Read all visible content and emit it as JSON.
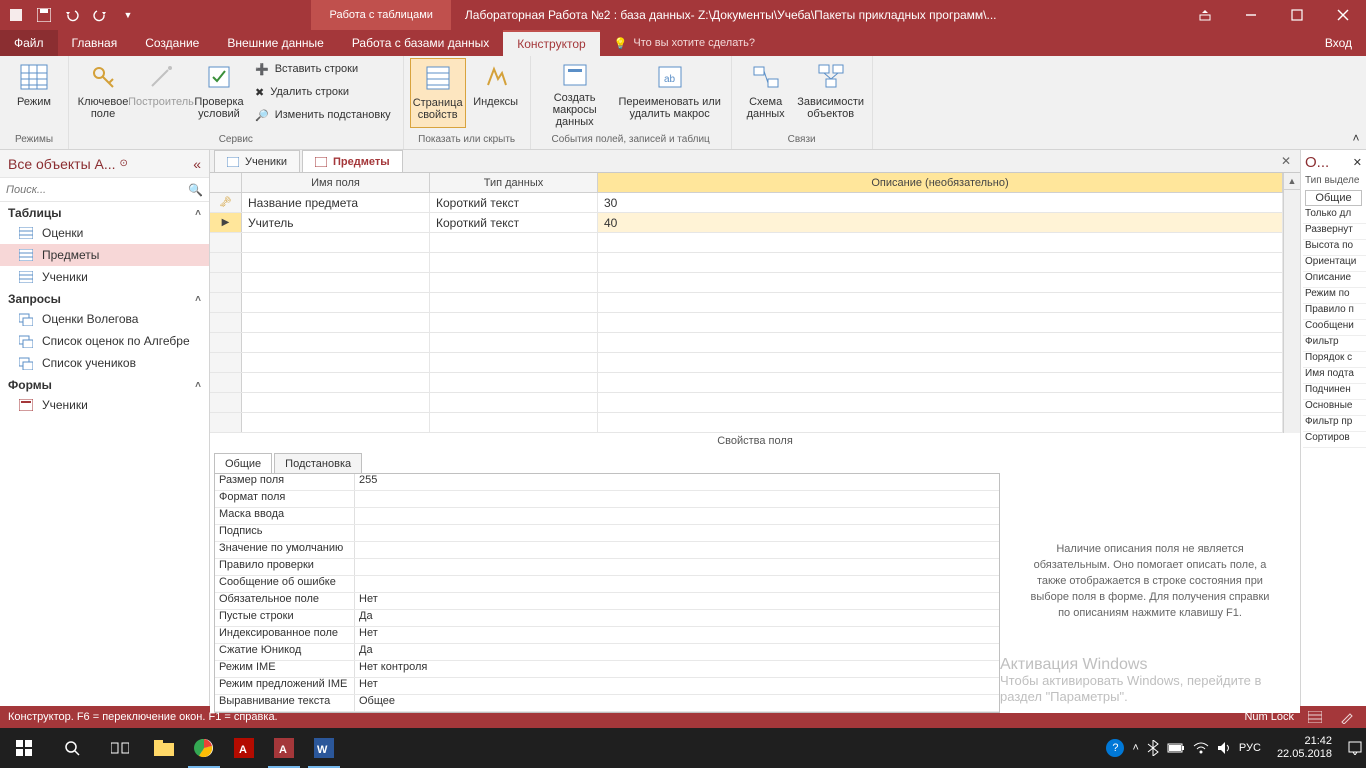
{
  "titlebar": {
    "context_label": "Работа с таблицами",
    "title": "Лабораторная Работа №2 : база данных- Z:\\Документы\\Учеба\\Пакеты прикладных программ\\..."
  },
  "ribbon_tabs": {
    "file": "Файл",
    "home": "Главная",
    "create": "Создание",
    "external": "Внешние данные",
    "dbtools": "Работа с базами данных",
    "design": "Конструктор",
    "tellme": "Что вы хотите сделать?",
    "signin": "Вход"
  },
  "ribbon": {
    "views": {
      "label": "Режимы",
      "view": "Режим"
    },
    "service": {
      "label": "Сервис",
      "pk": "Ключевое поле",
      "builder": "Построитель",
      "validate": "Проверка условий",
      "insert": "Вставить строки",
      "delete": "Удалить строки",
      "lookup": "Изменить подстановку"
    },
    "showhide": {
      "label": "Показать или скрыть",
      "propsheet": "Страница свойств",
      "indexes": "Индексы"
    },
    "events": {
      "label": "События полей, записей и таблиц",
      "datamacro": "Создать макросы данных",
      "rename": "Переименовать или удалить макрос"
    },
    "relations": {
      "label": "Связи",
      "rel": "Схема данных",
      "deps": "Зависимости объектов"
    }
  },
  "nav": {
    "header": "Все объекты A...",
    "search": "Поиск...",
    "groups": {
      "tables": "Таблицы",
      "queries": "Запросы",
      "forms": "Формы"
    },
    "tables": [
      "Оценки",
      "Предметы",
      "Ученики"
    ],
    "queries": [
      "Оценки Волегова",
      "Список оценок по Алгебре",
      "Список учеников"
    ],
    "forms": [
      "Ученики"
    ]
  },
  "tabs": {
    "t1": "Ученики",
    "t2": "Предметы"
  },
  "design_grid": {
    "col_name": "Имя поля",
    "col_type": "Тип данных",
    "col_desc": "Описание (необязательно)",
    "rows": [
      {
        "name": "Название предмета",
        "type": "Короткий текст",
        "desc": "30"
      },
      {
        "name": "Учитель",
        "type": "Короткий текст",
        "desc": "40"
      }
    ]
  },
  "field_props": {
    "section_label": "Свойства поля",
    "tab_general": "Общие",
    "tab_lookup": "Подстановка",
    "help": "Наличие описания поля не является обязательным. Оно помогает описать поле, а также отображается в строке состояния при выборе поля в форме. Для получения справки по описаниям нажмите клавишу F1.",
    "rows": [
      {
        "k": "Размер поля",
        "v": "255"
      },
      {
        "k": "Формат поля",
        "v": ""
      },
      {
        "k": "Маска ввода",
        "v": ""
      },
      {
        "k": "Подпись",
        "v": ""
      },
      {
        "k": "Значение по умолчанию",
        "v": ""
      },
      {
        "k": "Правило проверки",
        "v": ""
      },
      {
        "k": "Сообщение об ошибке",
        "v": ""
      },
      {
        "k": "Обязательное поле",
        "v": "Нет"
      },
      {
        "k": "Пустые строки",
        "v": "Да"
      },
      {
        "k": "Индексированное поле",
        "v": "Нет"
      },
      {
        "k": "Сжатие Юникод",
        "v": "Да"
      },
      {
        "k": "Режим IME",
        "v": "Нет контроля"
      },
      {
        "k": "Режим предложений IME",
        "v": "Нет"
      },
      {
        "k": "Выравнивание текста",
        "v": "Общее"
      }
    ]
  },
  "prop_sheet": {
    "title": "О...",
    "subtitle": "Тип выделе",
    "tab": "Общие",
    "rows": [
      "Только дл",
      "Развернут",
      "Высота по",
      "Ориентаци",
      "Описание",
      "Режим по",
      "Правило п",
      "Сообщени",
      "Фильтр",
      "Порядок с",
      "Имя подта",
      "Подчинен",
      "Основные",
      "Фильтр пр",
      "Сортиров"
    ]
  },
  "statusbar": {
    "left": "Конструктор.  F6 = переключение окон.  F1 = справка.",
    "numlock": "Num Lock"
  },
  "watermark": {
    "l1": "Активация Windows",
    "l2": "Чтобы активировать Windows, перейдите в раздел \"Параметры\"."
  },
  "taskbar": {
    "lang": "РУС",
    "time": "21:42",
    "date": "22.05.2018"
  }
}
